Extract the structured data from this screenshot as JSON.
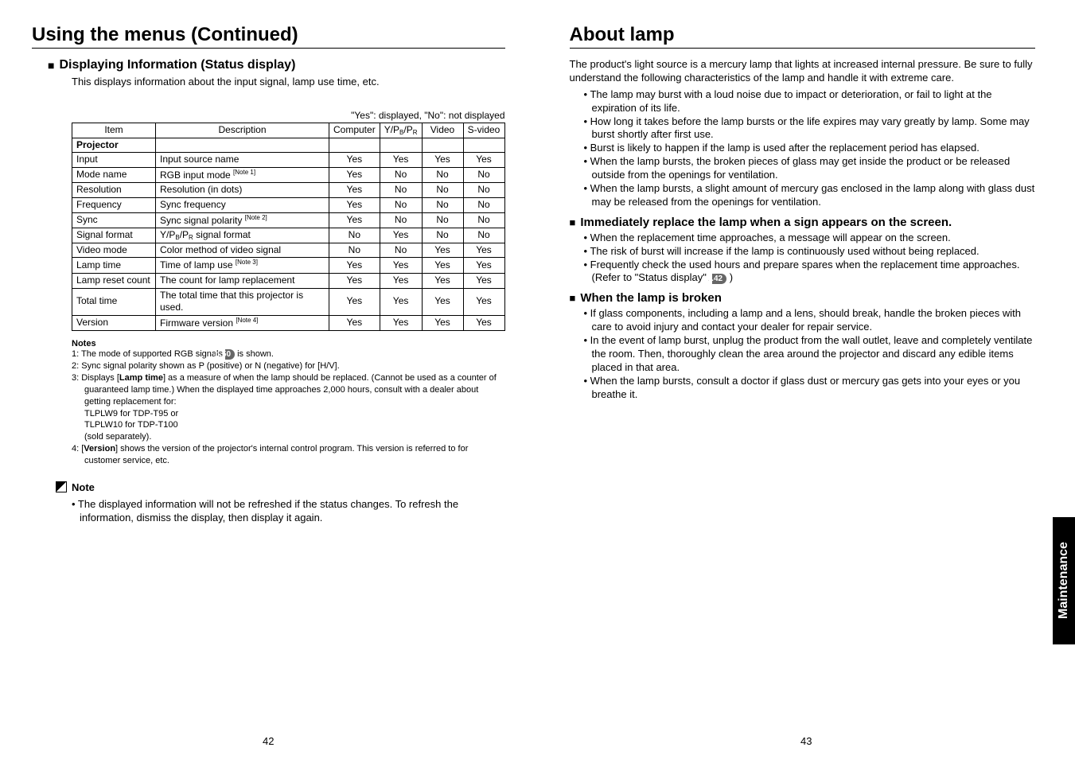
{
  "left": {
    "title": "Using the menus (Continued)",
    "subheading": "Displaying Information (Status display)",
    "subheading_desc": "This displays information about the input signal, lamp use time, etc.",
    "table_caption": "\"Yes\": displayed, \"No\": not displayed",
    "table": {
      "headers": {
        "item": "Item",
        "desc": "Description",
        "comp": "Computer",
        "ypbpr": "Y/PB/PR",
        "video": "Video",
        "svideo": "S-video"
      },
      "section": "Projector",
      "rows": [
        {
          "item": "Input",
          "desc": "Input source name",
          "comp": "Yes",
          "ypbpr": "Yes",
          "video": "Yes",
          "svideo": "Yes"
        },
        {
          "item": "Mode name",
          "desc": "RGB input mode [Note 1]",
          "note": 1,
          "comp": "Yes",
          "ypbpr": "No",
          "video": "No",
          "svideo": "No"
        },
        {
          "item": "Resolution",
          "desc": "Resolution (in dots)",
          "comp": "Yes",
          "ypbpr": "No",
          "video": "No",
          "svideo": "No"
        },
        {
          "item": "Frequency",
          "desc": "Sync frequency",
          "comp": "Yes",
          "ypbpr": "No",
          "video": "No",
          "svideo": "No"
        },
        {
          "item": "Sync",
          "desc": "Sync signal polarity [Note 2]",
          "note": 2,
          "comp": "Yes",
          "ypbpr": "No",
          "video": "No",
          "svideo": "No"
        },
        {
          "item": "Signal format",
          "desc": "Y/PB/PR signal format",
          "sub": true,
          "comp": "No",
          "ypbpr": "Yes",
          "video": "No",
          "svideo": "No"
        },
        {
          "item": "Video mode",
          "desc": "Color method of video signal",
          "comp": "No",
          "ypbpr": "No",
          "video": "Yes",
          "svideo": "Yes"
        },
        {
          "item": "Lamp time",
          "desc": "Time of lamp use [Note 3]",
          "note": 3,
          "comp": "Yes",
          "ypbpr": "Yes",
          "video": "Yes",
          "svideo": "Yes"
        },
        {
          "item": "Lamp reset count",
          "desc": "The count for lamp replacement",
          "comp": "Yes",
          "ypbpr": "Yes",
          "video": "Yes",
          "svideo": "Yes"
        },
        {
          "item": "Total time",
          "desc": "The total time that this projector is used.",
          "comp": "Yes",
          "ypbpr": "Yes",
          "video": "Yes",
          "svideo": "Yes"
        },
        {
          "item": "Version",
          "desc": "Firmware version [Note 4]",
          "note": 4,
          "comp": "Yes",
          "ypbpr": "Yes",
          "video": "Yes",
          "svideo": "Yes"
        }
      ]
    },
    "notes_label": "Notes",
    "notes": {
      "n1_pre": "1: The mode of supported RGB signals ",
      "n1_ref": "p.50",
      "n1_post": " is shown.",
      "n2": "2: Sync signal polarity shown as P (positive) or N (negative) for [H/V].",
      "n3a": "3: Displays [",
      "n3b": "Lamp time",
      "n3c": "] as a measure of when the lamp should be replaced. (Cannot be used as a counter of guaranteed lamp time.) When the displayed time approaches 2,000 hours,  consult with a dealer about getting replacement for:",
      "n3d": "TLPLW9 for TDP-T95 or",
      "n3e": "TLPLW10 for TDP-T100",
      "n3f": "(sold separately).",
      "n4a": "4: [",
      "n4b": "Version",
      "n4c": "] shows the version of the projector's internal control program. This version is referred to for customer service, etc."
    },
    "note_box_label": "Note",
    "note_box_text": "• The displayed information will not be refreshed if the status changes. To refresh the information, dismiss the display, then display it again.",
    "page_num": "42"
  },
  "right": {
    "title": "About lamp",
    "intro1": "The product's light source is a mercury lamp that lights at increased internal pressure. Be sure to fully understand the following characteristics of the lamp and handle it with extreme care.",
    "bullets1": [
      "The lamp may burst with a loud noise due to impact or deterioration, or fail to light at the expiration of its life.",
      "How long it takes before the lamp bursts or the life expires may vary greatly by lamp. Some may burst shortly after first use.",
      "Burst is likely to happen if the lamp is used after the replacement period has elapsed.",
      "When the lamp bursts, the broken pieces of glass may get inside the product or be released outside from the openings for ventilation.",
      "When the lamp bursts, a slight amount of mercury gas enclosed in the lamp along with glass dust may be released from the openings for ventilation."
    ],
    "sub2": "Immediately replace the lamp when a sign appears on the screen.",
    "bullets2": [
      "When the replacement time approaches, a message will appear on the screen.",
      "The risk of burst will increase if the lamp is continuously used without being replaced."
    ],
    "bullet2c_pre": "Frequently check the used hours and prepare spares when the replacement time approaches. (Refer to \"Status display\". ",
    "bullet2c_ref": "p.42",
    "bullet2c_post": " )",
    "sub3": "When the lamp is broken",
    "bullets3": [
      "If glass components, including a lamp and a lens, should break, handle the broken pieces with care to avoid injury and contact your dealer for repair service.",
      "In the event of lamp burst, unplug the product from the wall outlet, leave and completely ventilate the room. Then, thoroughly clean the area around the projector and discard any edible items placed in that area.",
      "When the lamp bursts, consult a doctor if glass dust or mercury gas gets into your eyes or you breathe it."
    ],
    "side_tab": "Maintenance",
    "page_num": "43"
  }
}
